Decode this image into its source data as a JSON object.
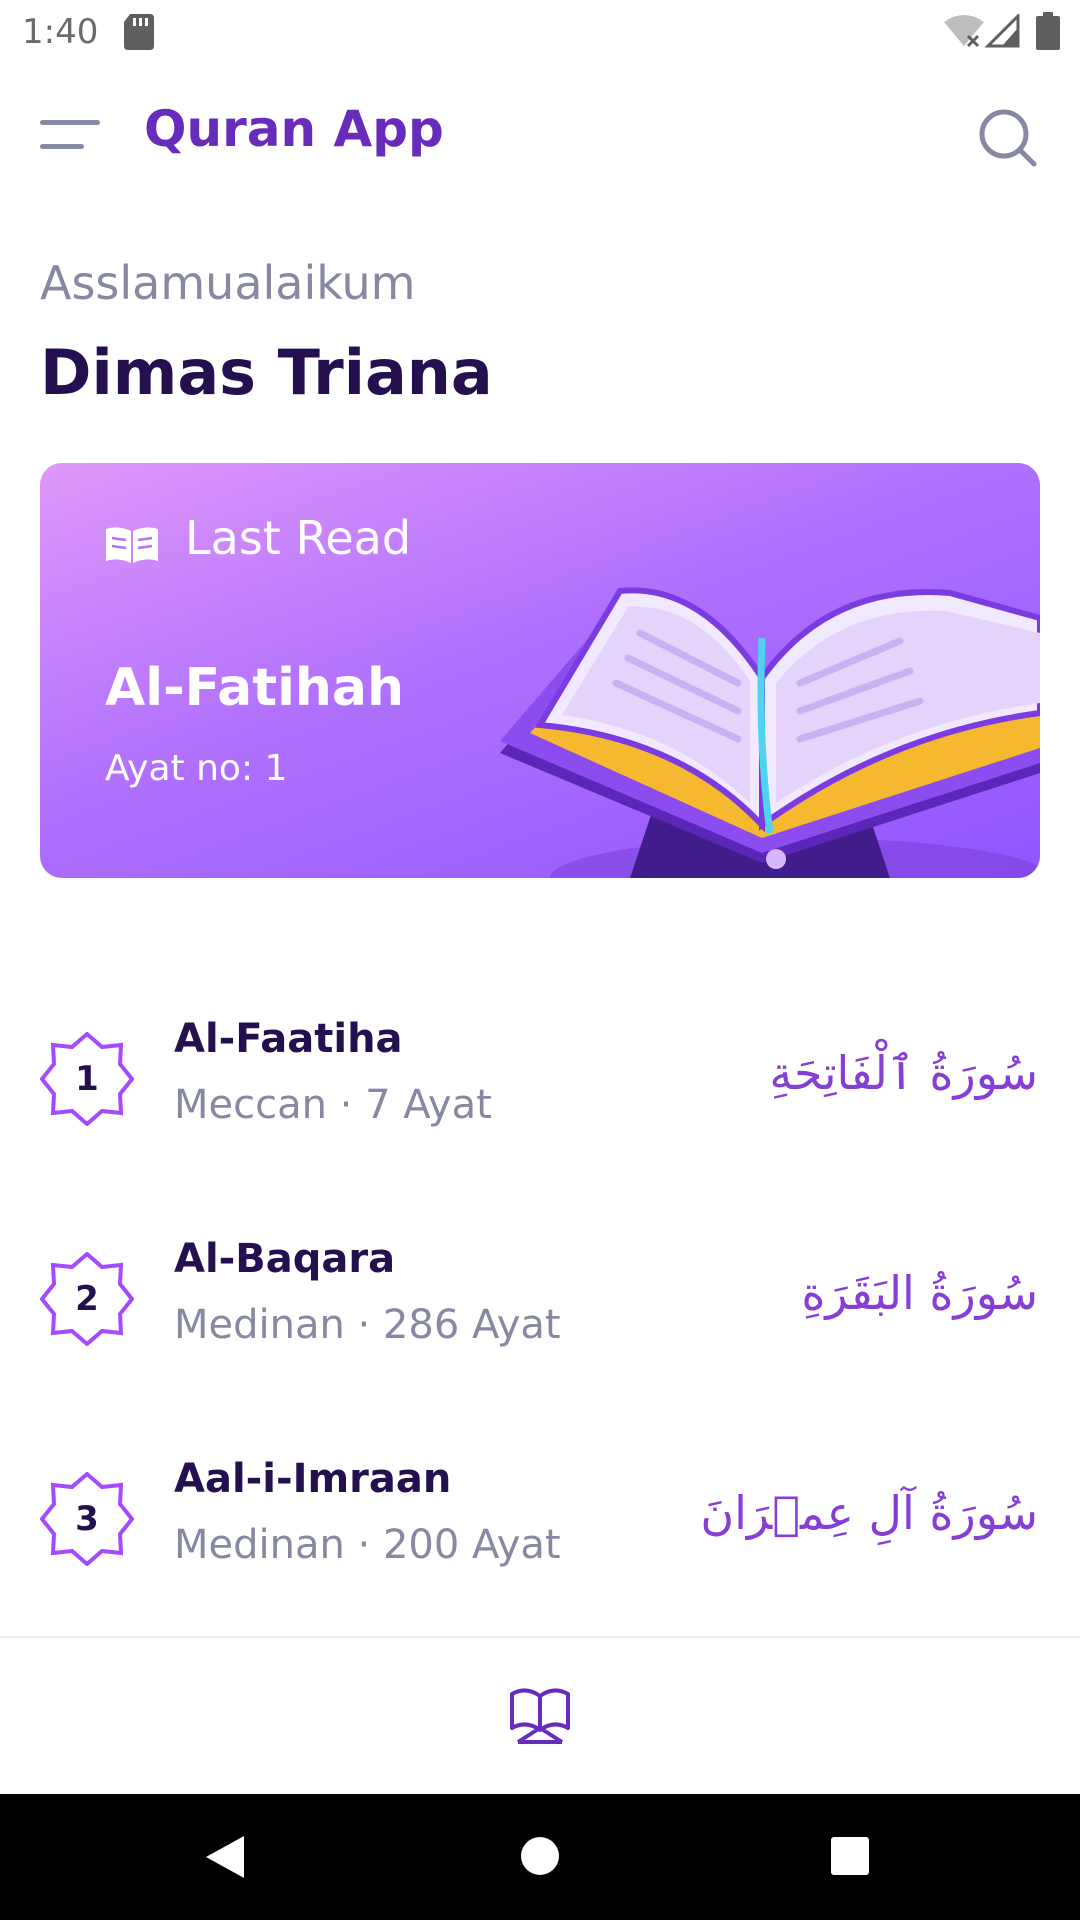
{
  "status_bar": {
    "time": "1:40",
    "icons": [
      "sd-card-icon",
      "wifi-off-icon",
      "signal-icon",
      "battery-icon"
    ]
  },
  "app_bar": {
    "title": "Quran App",
    "menu_icon": "menu-icon",
    "search_icon": "search-icon"
  },
  "greeting": {
    "salutation": "Asslamualaikum",
    "user_name": "Dimas Triana"
  },
  "last_read": {
    "label": "Last Read",
    "surah": "Al-Fatihah",
    "ayat": "Ayat no: 1",
    "icon": "open-book-icon"
  },
  "surahs": [
    {
      "number": "1",
      "name": "Al-Faatiha",
      "meta": "Meccan · 7 Ayat",
      "arabic": "سُورَةُ ٱلْفَاتِحَةِ"
    },
    {
      "number": "2",
      "name": "Al-Baqara",
      "meta": "Medinan · 286 Ayat",
      "arabic": "سُورَةُ البَقَرَةِ"
    },
    {
      "number": "3",
      "name": "Aal-i-Imraan",
      "meta": "Medinan · 200 Ayat",
      "arabic": "سُورَةُ آلِ عِمۡرَانَ"
    }
  ],
  "bottom_nav": {
    "items": [
      {
        "icon": "quran-icon",
        "active": true
      }
    ]
  },
  "colors": {
    "primary": "#672CBC",
    "dark_text": "#240F4F",
    "muted_text": "#8789A3",
    "arabic": "#863ED5",
    "card_gradient_start": "#DF98FA",
    "card_gradient_end": "#9055FF"
  }
}
